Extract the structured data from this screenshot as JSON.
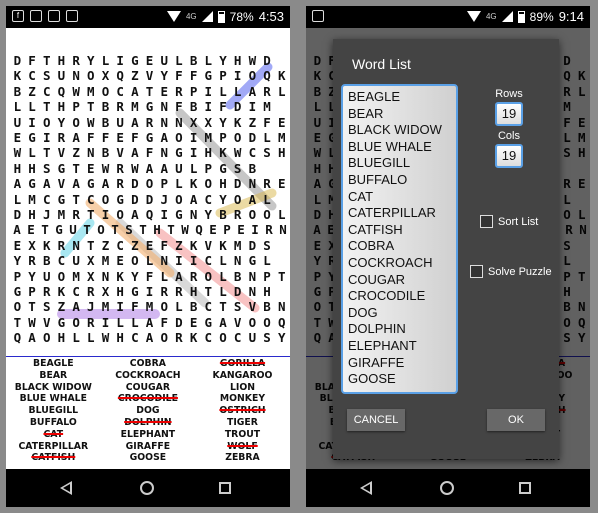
{
  "left_screen": {
    "status": {
      "battery": "78%",
      "time": "4:53"
    },
    "grid_rows": [
      "DFTHRYLIGEULBLYHWD",
      "KCSUNOXQZVYFFGPIOQK",
      "BZCQWMOCATERPILLARL",
      "LLTHPTBRMGNFBIFDIM",
      "UIOYOWBUARNNXXYKZFE",
      "EGIRAFFEFGAOIMPODLM",
      "WLTVZNBVAFNGIHKWCSH",
      "HHSGTEWRWAAULPGSB",
      "AGAVAGARDOPLKOHDNRE",
      "LMCGTCOGDDJOACYOAL",
      "DHJMRTIOAQIGNYBROOL",
      "AETGUTOTSTHTWQEPEIRN",
      "EXKRNTZCZEFZKVKMDS",
      "YRBCUXMEOLNIICLNGL",
      "PYUOMXNKYFLAROLBNPT",
      "GPRKCRXHGIRRHTLDNH",
      "OTSZAJMIFMOLBCTSVBN",
      "TWVGORILLAFDEGAVOOQ",
      "QAOHLLWHCAORKCOCUSY"
    ],
    "words_columns": [
      [
        "BEAGLE",
        "BEAR",
        "BLACK WIDOW",
        "BLUE WHALE",
        "BLUEGILL",
        "BUFFALO",
        "CAT",
        "CATERPILLAR",
        "CATFISH"
      ],
      [
        "COBRA",
        "COCKROACH",
        "COUGAR",
        "CROCODILE",
        "DOG",
        "DOLPHIN",
        "ELEPHANT",
        "GIRAFFE",
        "GOOSE"
      ],
      [
        "GORILLA",
        "KANGAROO",
        "LION",
        "MONKEY",
        "OSTRICH",
        "TIGER",
        "TROUT",
        "WOLF",
        "ZEBRA"
      ]
    ],
    "words_found": [
      "CAT",
      "CATFISH",
      "CROCODILE",
      "DOLPHIN",
      "GORILLA",
      "OSTRICH",
      "WOLF"
    ]
  },
  "right_screen": {
    "status": {
      "battery": "89%",
      "time": "9:14"
    },
    "dialog": {
      "title": "Word List",
      "words": [
        "BEAGLE",
        "BEAR",
        "BLACK WIDOW",
        "BLUE WHALE",
        "BLUEGILL",
        "BUFFALO",
        "CAT",
        "CATERPILLAR",
        "CATFISH",
        "COBRA",
        "COCKROACH",
        "COUGAR",
        "CROCODILE",
        "DOG",
        "DOLPHIN",
        "ELEPHANT",
        "GIRAFFE",
        "GOOSE"
      ],
      "rows_label": "Rows",
      "rows_value": "19",
      "cols_label": "Cols",
      "cols_value": "19",
      "sort_label": "Sort List",
      "solve_label": "Solve Puzzle",
      "cancel_label": "CANCEL",
      "ok_label": "OK"
    }
  },
  "icons": [
    "facebook-icon",
    "image-icon",
    "android-icon",
    "notification-icon",
    "wifi-icon",
    "signal-icon",
    "battery-icon",
    "back-icon",
    "home-icon",
    "recent-apps-icon"
  ],
  "colors": {
    "status_bar": "#000000",
    "dialog": "#444444",
    "accent_border": "#5aa0e6",
    "strike": "#e00000",
    "divider": "#2a2acc"
  }
}
